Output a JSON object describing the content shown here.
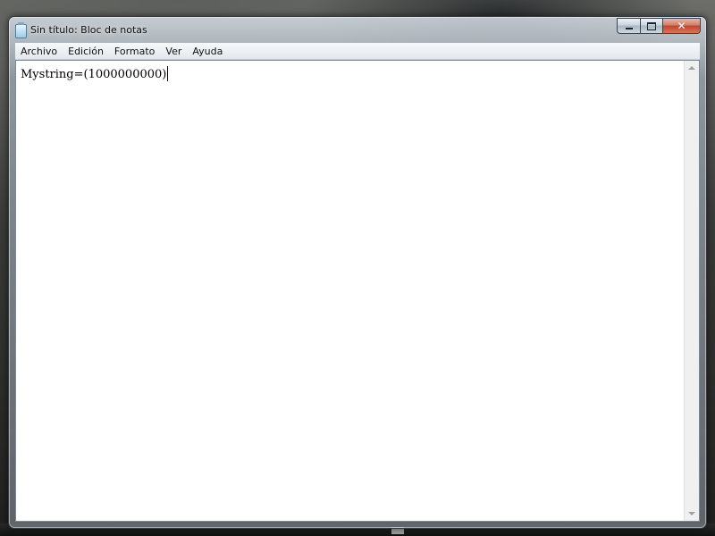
{
  "window": {
    "title": "Sin título: Bloc de notas",
    "controls": {
      "minimize_icon": "minimize-icon",
      "maximize_icon": "maximize-icon",
      "close_label": "✕"
    }
  },
  "menubar": {
    "items": [
      {
        "label": "Archivo"
      },
      {
        "label": "Edición"
      },
      {
        "label": "Formato"
      },
      {
        "label": "Ver"
      },
      {
        "label": "Ayuda"
      }
    ]
  },
  "editor": {
    "content": "Mystring=(1000000000)"
  },
  "colors": {
    "close_button": "#c0452a",
    "editor_background": "#ffffff",
    "menubar_background": "#f0f3f7"
  }
}
